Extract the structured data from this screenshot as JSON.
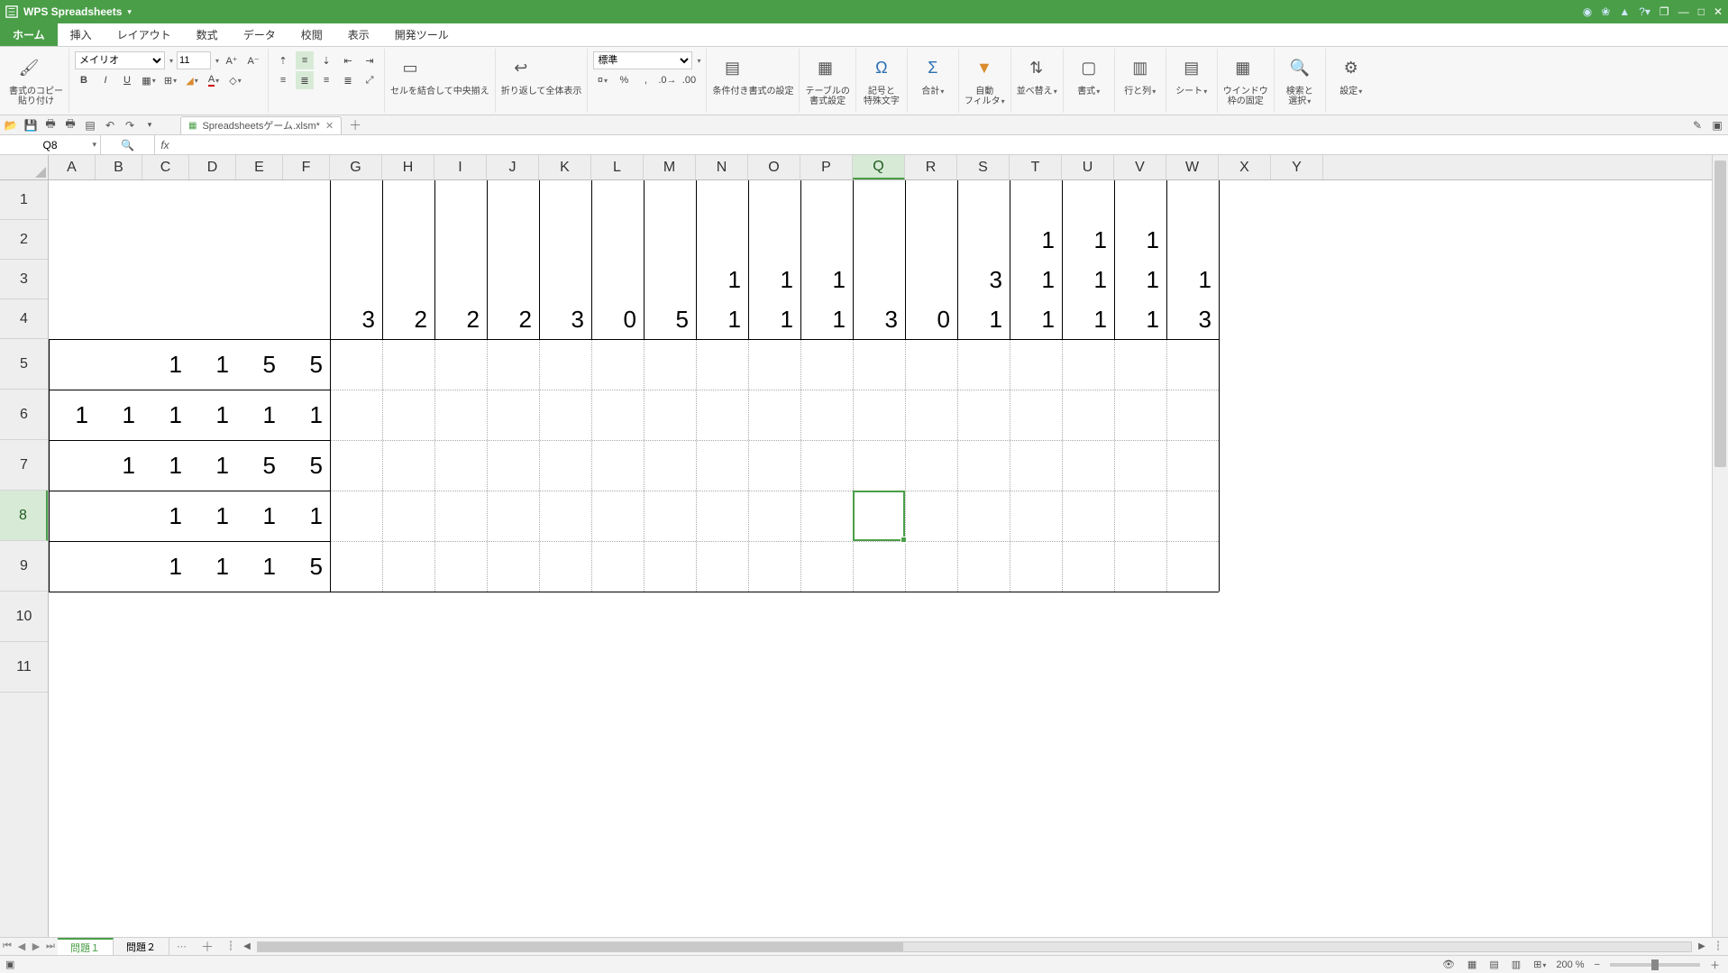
{
  "app": {
    "title": "WPS Spreadsheets"
  },
  "menu": {
    "tabs": [
      "ホーム",
      "挿入",
      "レイアウト",
      "数式",
      "データ",
      "校閲",
      "表示",
      "開発ツール"
    ],
    "active": 0
  },
  "ribbon": {
    "clipboard": {
      "copy_lbl": "書式のコピー",
      "paste_lbl": "貼り付け"
    },
    "font": {
      "name": "メイリオ",
      "size": "11"
    },
    "merge_lbl": "セルを結合して中央揃え",
    "wrap_lbl": "折り返して全体表示",
    "num_style": "標準",
    "cond_fmt": "条件付き書式の設定",
    "table_fmt1": "テーブルの",
    "table_fmt2": "書式設定",
    "symbol1": "記号と",
    "symbol2": "特殊文字",
    "sum": "合計",
    "filter1": "自動",
    "filter2": "フィルタ",
    "sort": "並べ替え",
    "format": "書式",
    "rowcol": "行と列",
    "sheet": "シート",
    "freeze1": "ウインドウ",
    "freeze2": "枠の固定",
    "find1": "検索と",
    "find2": "選択",
    "settings": "設定"
  },
  "filetab": {
    "name": "Spreadsheetsゲーム.xlsm*"
  },
  "namebox": "Q8",
  "formula": "",
  "columns": [
    "A",
    "B",
    "C",
    "D",
    "E",
    "F",
    "G",
    "H",
    "I",
    "J",
    "K",
    "L",
    "M",
    "N",
    "O",
    "P",
    "Q",
    "R",
    "S",
    "T",
    "U",
    "V",
    "W",
    "X",
    "Y"
  ],
  "col_widths_factor": {
    "default": 58,
    "override": {
      "A": 52,
      "B": 52,
      "C": 52,
      "D": 52,
      "E": 52,
      "F": 52
    }
  },
  "row_heights": {
    "1": 44,
    "2": 44,
    "3": 44,
    "4": 44,
    "5": 56,
    "6": 56,
    "7": 56,
    "8": 56,
    "9": 56,
    "10": 56,
    "11": 56
  },
  "active_col": "Q",
  "active_row": 8,
  "cells": {
    "T2": "1",
    "U2": "1",
    "V2": "1",
    "N3": "1",
    "O3": "1",
    "P3": "1",
    "S3": "3",
    "T3": "1",
    "U3": "1",
    "V3": "1",
    "W3": "1",
    "G4": "3",
    "H4": "2",
    "I4": "2",
    "J4": "2",
    "K4": "3",
    "L4": "0",
    "M4": "5",
    "N4": "1",
    "O4": "1",
    "P4": "1",
    "Q4": "3",
    "R4": "0",
    "S4": "1",
    "T4": "1",
    "U4": "1",
    "V4": "1",
    "W4": "3",
    "C5": "1",
    "D5": "1",
    "E5": "5",
    "F5": "5",
    "A6": "1",
    "B6": "1",
    "C6": "1",
    "D6": "1",
    "E6": "1",
    "F6": "1",
    "B7": "1",
    "C7": "1",
    "D7": "1",
    "E7": "5",
    "F7": "5",
    "C8": "1",
    "D8": "1",
    "E8": "1",
    "F8": "1",
    "C9": "1",
    "D9": "1",
    "E9": "1",
    "F9": "5"
  },
  "solid_borders": {
    "v": [
      {
        "col": "G",
        "r1": 1,
        "r2": 9
      },
      {
        "col": "X",
        "r1": 1,
        "r2": 9
      }
    ],
    "h": [
      {
        "row_after": 4,
        "c1": "A",
        "c2": "W"
      },
      {
        "row_after": 9,
        "c1": "A",
        "c2": "W"
      }
    ],
    "hint_box_v": [
      {
        "col": "A",
        "r1": 5,
        "r2": 9
      },
      {
        "col": "G",
        "r1": 5,
        "r2": 9
      }
    ],
    "hint_box_h": [
      {
        "row_after": 5,
        "c1": "A",
        "c2": "F"
      },
      {
        "row_after": 6,
        "c1": "A",
        "c2": "F"
      },
      {
        "row_after": 7,
        "c1": "A",
        "c2": "F"
      },
      {
        "row_after": 8,
        "c1": "A",
        "c2": "F"
      }
    ]
  },
  "sheets": {
    "tabs": [
      "問題１",
      "問題２"
    ],
    "active": 0
  },
  "status": {
    "zoom": "200 %"
  }
}
